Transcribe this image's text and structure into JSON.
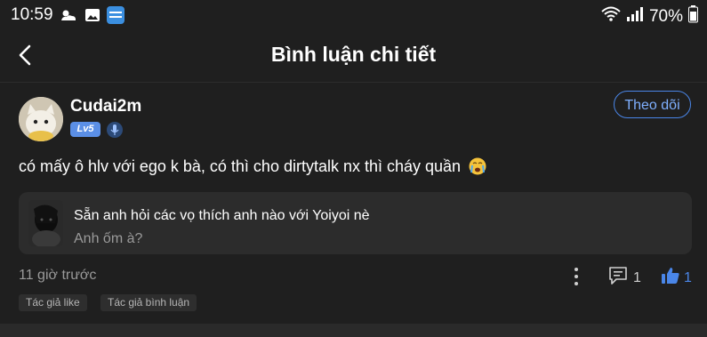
{
  "status_bar": {
    "time": "10:59",
    "battery": "70%",
    "left_icons": [
      "weather-icon",
      "gallery-icon",
      "app-notification-icon"
    ],
    "right_icons": [
      "wifi-icon",
      "signal-icon"
    ]
  },
  "app_bar": {
    "title": "Bình luận chi tiết"
  },
  "comment": {
    "username": "Cudai2m",
    "level": "Lv5",
    "follow_label": "Theo dõi",
    "text": "có mấy ô hlv với ego k bà, có thì cho dirtytalk nx thì cháy quần",
    "emoji": "crying-face-emoji"
  },
  "quoted": {
    "text": "Sẵn anh hỏi các vọ thích anh nào với Yoiyoi nè",
    "subtext": "Anh ốm à?"
  },
  "meta": {
    "time_ago": "11 giờ trước",
    "comment_count": "1",
    "like_count": "1"
  },
  "tags": [
    "Tác giả like",
    "Tác giả bình luận"
  ],
  "colors": {
    "background": "#1f1f1f",
    "accent": "#4a86e8",
    "card": "#2c2c2c",
    "muted_text": "#9a9a9a"
  }
}
